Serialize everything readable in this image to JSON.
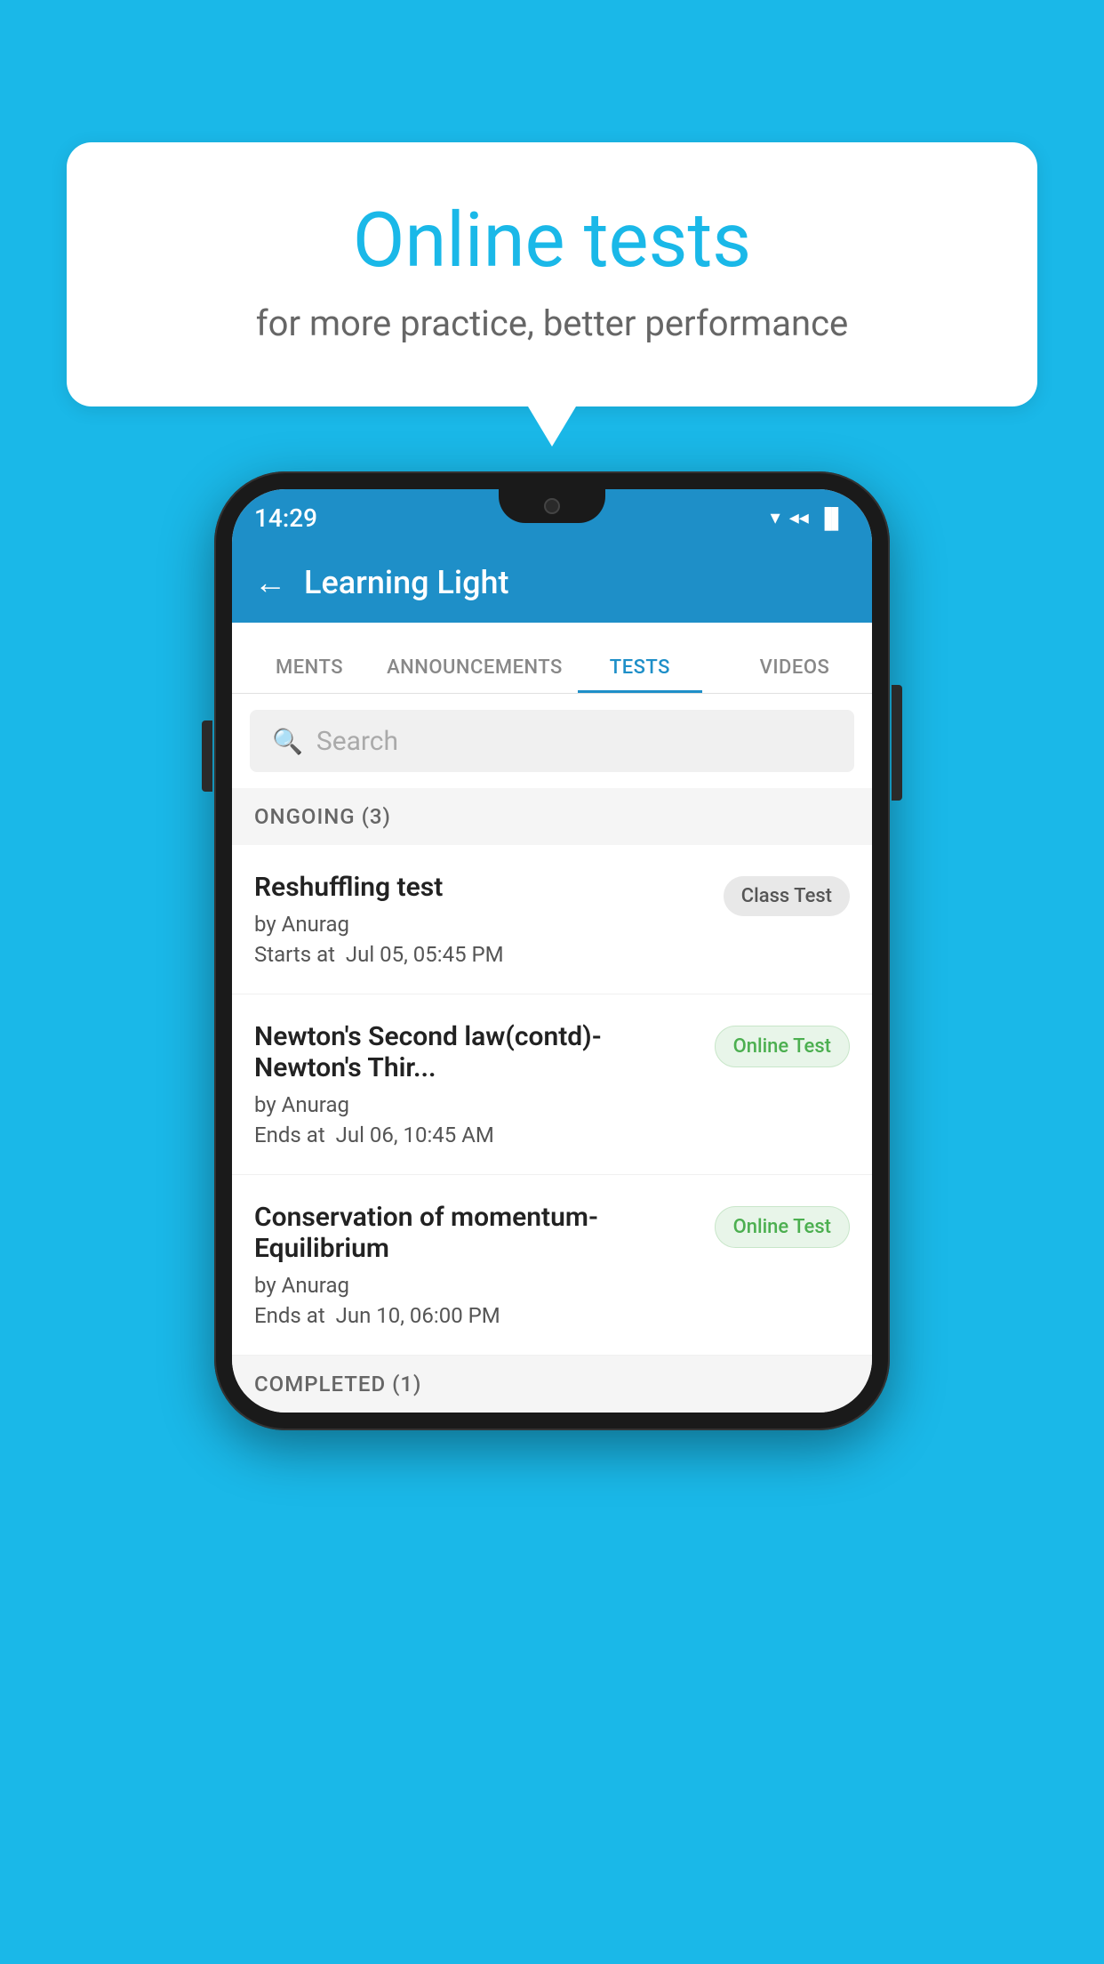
{
  "background_color": "#1ab8e8",
  "bubble": {
    "title": "Online tests",
    "subtitle": "for more practice, better performance"
  },
  "phone": {
    "status_bar": {
      "time": "14:29",
      "wifi": "▼",
      "signal": "▲",
      "battery": "▐"
    },
    "header": {
      "back_label": "←",
      "title": "Learning Light"
    },
    "tabs": [
      {
        "label": "MENTS",
        "active": false
      },
      {
        "label": "ANNOUNCEMENTS",
        "active": false
      },
      {
        "label": "TESTS",
        "active": true
      },
      {
        "label": "VIDEOS",
        "active": false
      }
    ],
    "search": {
      "placeholder": "Search"
    },
    "sections": [
      {
        "title": "ONGOING (3)",
        "tests": [
          {
            "name": "Reshuffling test",
            "author": "by Anurag",
            "time_label": "Starts at",
            "time": "Jul 05, 05:45 PM",
            "badge": "Class Test",
            "badge_type": "class"
          },
          {
            "name": "Newton's Second law(contd)-Newton's Thir...",
            "author": "by Anurag",
            "time_label": "Ends at",
            "time": "Jul 06, 10:45 AM",
            "badge": "Online Test",
            "badge_type": "online"
          },
          {
            "name": "Conservation of momentum-Equilibrium",
            "author": "by Anurag",
            "time_label": "Ends at",
            "time": "Jun 10, 06:00 PM",
            "badge": "Online Test",
            "badge_type": "online"
          }
        ]
      }
    ],
    "completed_section": {
      "title": "COMPLETED (1)"
    }
  }
}
